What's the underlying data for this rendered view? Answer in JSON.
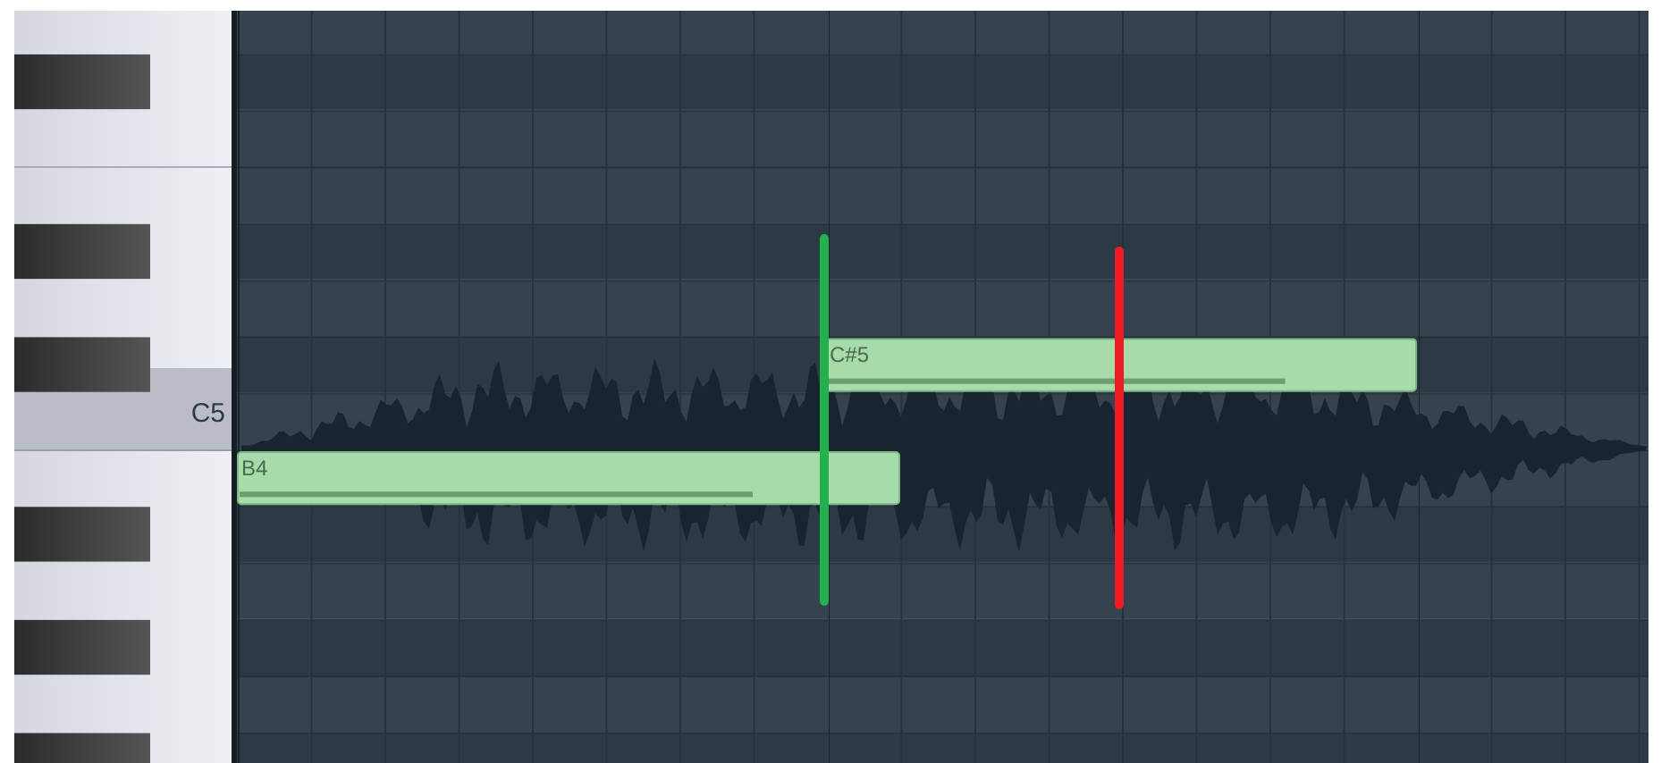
{
  "keyboard": {
    "label": "C5"
  },
  "notes": [
    {
      "label": "B4",
      "level": 0.78
    },
    {
      "label": "C#5",
      "level": 0.78
    }
  ],
  "markers": [
    {
      "color": "#22b14c"
    },
    {
      "color": "#ed1c24"
    }
  ]
}
